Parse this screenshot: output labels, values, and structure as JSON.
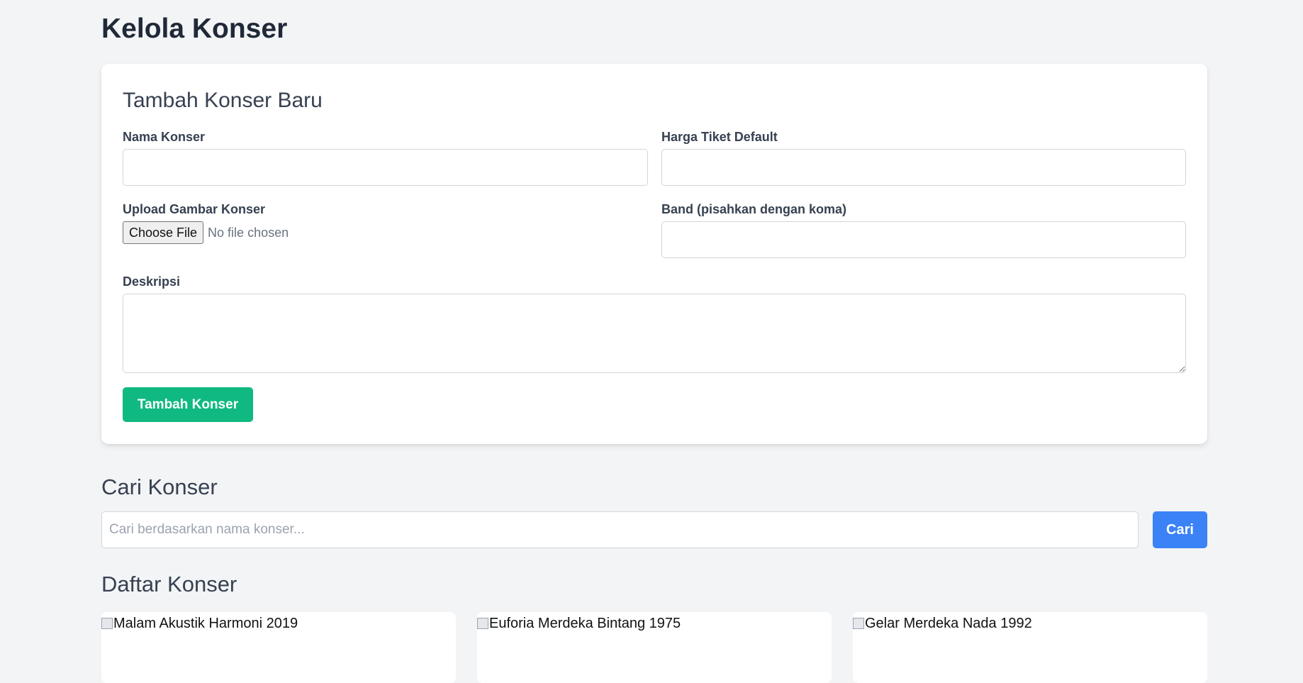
{
  "page": {
    "title": "Kelola Konser"
  },
  "add_form": {
    "title": "Tambah Konser Baru",
    "name_label": "Nama Konser",
    "name_value": "",
    "price_label": "Harga Tiket Default",
    "price_value": "",
    "image_label": "Upload Gambar Konser",
    "file_button_label": "Choose File",
    "file_status": "No file chosen",
    "band_label": "Band (pisahkan dengan koma)",
    "band_value": "",
    "description_label": "Deskripsi",
    "description_value": "",
    "submit_label": "Tambah Konser",
    "submit_color": "#10b981"
  },
  "search": {
    "title": "Cari Konser",
    "placeholder": "Cari berdasarkan nama konser...",
    "value": "",
    "button_label": "Cari",
    "button_color": "#3b82f6"
  },
  "list": {
    "title": "Daftar Konser",
    "concerts": [
      {
        "image_alt": "Malam Akustik Harmoni 2019",
        "icon": "broken-image-icon"
      },
      {
        "image_alt": "Euforia Merdeka Bintang 1975",
        "icon": "broken-image-icon"
      },
      {
        "image_alt": "Gelar Merdeka Nada 1992",
        "icon": "broken-image-icon"
      }
    ]
  }
}
